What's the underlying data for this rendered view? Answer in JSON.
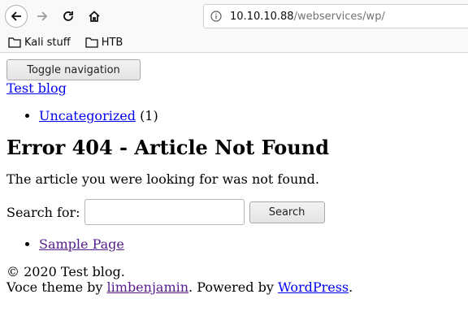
{
  "browser": {
    "url_host": "10.10.10.88",
    "url_path": "/webservices/wp/",
    "bookmarks": [
      {
        "label": "Kali stuff"
      },
      {
        "label": "HTB"
      }
    ]
  },
  "page": {
    "toggle_nav_label": "Toggle navigation",
    "site_title": "Test blog",
    "categories": [
      {
        "label": "Uncategorized",
        "count": "(1)"
      }
    ],
    "heading": "Error 404 - Article Not Found",
    "message": "The article you were looking for was not found.",
    "search": {
      "label": "Search for:",
      "value": "",
      "button_label": "Search"
    },
    "pages": [
      {
        "label": "Sample Page"
      }
    ],
    "footer": {
      "copyright": "© 2020 Test blog.",
      "theme_prefix": "Voce theme by ",
      "theme_author": "limbenjamin",
      "powered_prefix": ". Powered by ",
      "powered_link": "WordPress",
      "powered_suffix": "."
    }
  }
}
